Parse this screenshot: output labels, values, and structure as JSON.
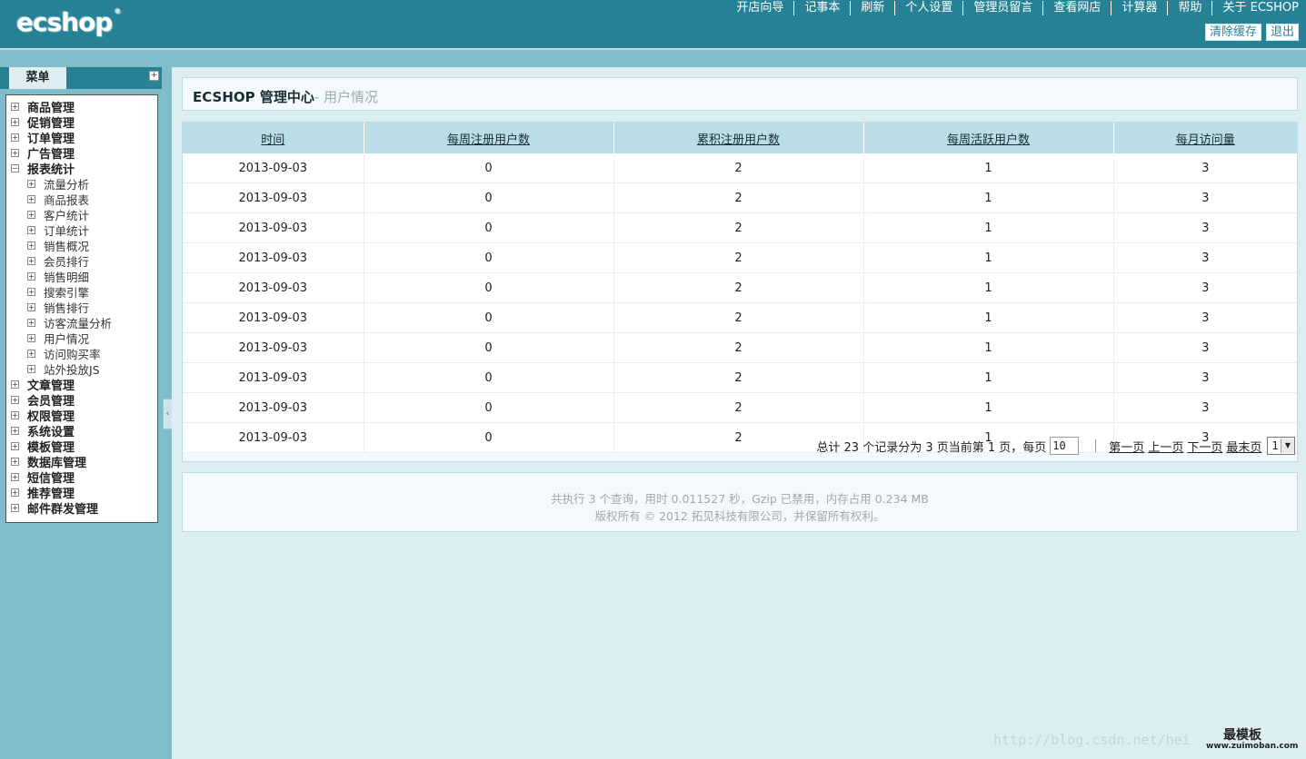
{
  "header": {
    "logo": "ecshop",
    "nav": [
      "开店向导",
      "记事本",
      "刷新",
      "个人设置",
      "管理员留言",
      "查看网店",
      "计算器",
      "帮助",
      "关于 ECSHOP"
    ],
    "buttons": {
      "clear_cache": "清除缓存",
      "logout": "退出"
    }
  },
  "sidebar": {
    "tab_label": "菜单",
    "toggle_icon": "plus-icon",
    "menus": [
      {
        "label": "商品管理",
        "expanded": false
      },
      {
        "label": "促销管理",
        "expanded": false
      },
      {
        "label": "订单管理",
        "expanded": false
      },
      {
        "label": "广告管理",
        "expanded": false
      },
      {
        "label": "报表统计",
        "expanded": true,
        "children": [
          "流量分析",
          "商品报表",
          "客户统计",
          "订单统计",
          "销售概况",
          "会员排行",
          "销售明细",
          "搜索引擎",
          "销售排行",
          "访客流量分析",
          "用户情况",
          "访问购买率",
          "站外投放JS"
        ]
      },
      {
        "label": "文章管理",
        "expanded": false
      },
      {
        "label": "会员管理",
        "expanded": false
      },
      {
        "label": "权限管理",
        "expanded": false
      },
      {
        "label": "系统设置",
        "expanded": false
      },
      {
        "label": "模板管理",
        "expanded": false
      },
      {
        "label": "数据库管理",
        "expanded": false
      },
      {
        "label": "短信管理",
        "expanded": false
      },
      {
        "label": "推荐管理",
        "expanded": false
      },
      {
        "label": "邮件群发管理",
        "expanded": false
      }
    ]
  },
  "page": {
    "title": "ECSHOP 管理中心",
    "subtitle": "- 用户情况"
  },
  "table": {
    "columns": [
      "时间",
      "每周注册用户数",
      "累积注册用户数",
      "每周活跃用户数",
      "每月访问量"
    ],
    "rows": [
      [
        "2013-09-03",
        "0",
        "2",
        "1",
        "3"
      ],
      [
        "2013-09-03",
        "0",
        "2",
        "1",
        "3"
      ],
      [
        "2013-09-03",
        "0",
        "2",
        "1",
        "3"
      ],
      [
        "2013-09-03",
        "0",
        "2",
        "1",
        "3"
      ],
      [
        "2013-09-03",
        "0",
        "2",
        "1",
        "3"
      ],
      [
        "2013-09-03",
        "0",
        "2",
        "1",
        "3"
      ],
      [
        "2013-09-03",
        "0",
        "2",
        "1",
        "3"
      ],
      [
        "2013-09-03",
        "0",
        "2",
        "1",
        "3"
      ],
      [
        "2013-09-03",
        "0",
        "2",
        "1",
        "3"
      ],
      [
        "2013-09-03",
        "0",
        "2",
        "1",
        "3"
      ]
    ]
  },
  "pager": {
    "summary": "总计 23 个记录分为 3 页当前第 1 页，每页",
    "page_size": "10",
    "links": [
      "第一页",
      "上一页",
      "下一页",
      "最末页"
    ],
    "current_page": "1"
  },
  "footer": {
    "line1": "共执行 3 个查询，用时 0.011527 秒，Gzip 已禁用，内存占用 0.234 MB",
    "line2": "版权所有 © 2012 拓见科技有限公司，并保留所有权利。"
  },
  "watermark": {
    "text": "http://blog.csdn.net/hei",
    "logo": "最模板",
    "url": "www.zuimoban.com"
  },
  "colors": {
    "header_bg": "#278296",
    "page_bg": "#80bdcb",
    "main_bg": "#ddeef2",
    "table_header_bg": "#bbdde5"
  }
}
